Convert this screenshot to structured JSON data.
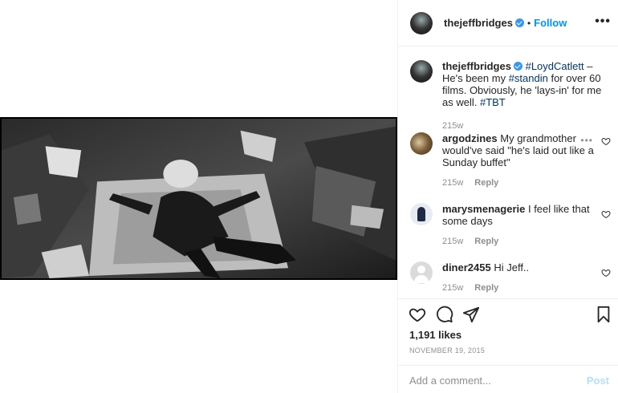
{
  "post": {
    "author": "thejeffbridges",
    "follow_label": "Follow",
    "separator": "•",
    "more_label": "•••",
    "photo_alt": "Black and white photo of a man lying spread-eagle on a mat",
    "caption": {
      "username": "thejeffbridges",
      "tag1": "#LoydCatlett",
      "text1": " – He's been my ",
      "tag2": "#standin",
      "text2": " for over 60 films. Obviously, he 'lays-in' for me as well. ",
      "tag3": "#TBT",
      "time": "215w"
    }
  },
  "comments": [
    {
      "username": "argodzines",
      "text": "My grandmother would've said \"he's laid out like a Sunday buffet\"",
      "time": "215w",
      "reply": "Reply",
      "more": "•••"
    },
    {
      "username": "marysmenagerie",
      "text": "I feel like that some days",
      "time": "215w",
      "reply": "Reply"
    },
    {
      "username": "diner2455",
      "text": "Hi Jeff..",
      "time": "215w",
      "reply": "Reply"
    }
  ],
  "actions": {
    "likes": "1,191 likes",
    "date": "NOVEMBER 19, 2015"
  },
  "composer": {
    "placeholder": "Add a comment...",
    "post_label": "Post"
  },
  "icons": [
    "heart-icon",
    "comment-icon",
    "share-icon",
    "bookmark-icon",
    "verified-icon",
    "more-icon"
  ],
  "colors": {
    "link": "#00376b",
    "follow": "#0095f6",
    "verified": "#3897f0",
    "muted": "#8e8e8e"
  }
}
